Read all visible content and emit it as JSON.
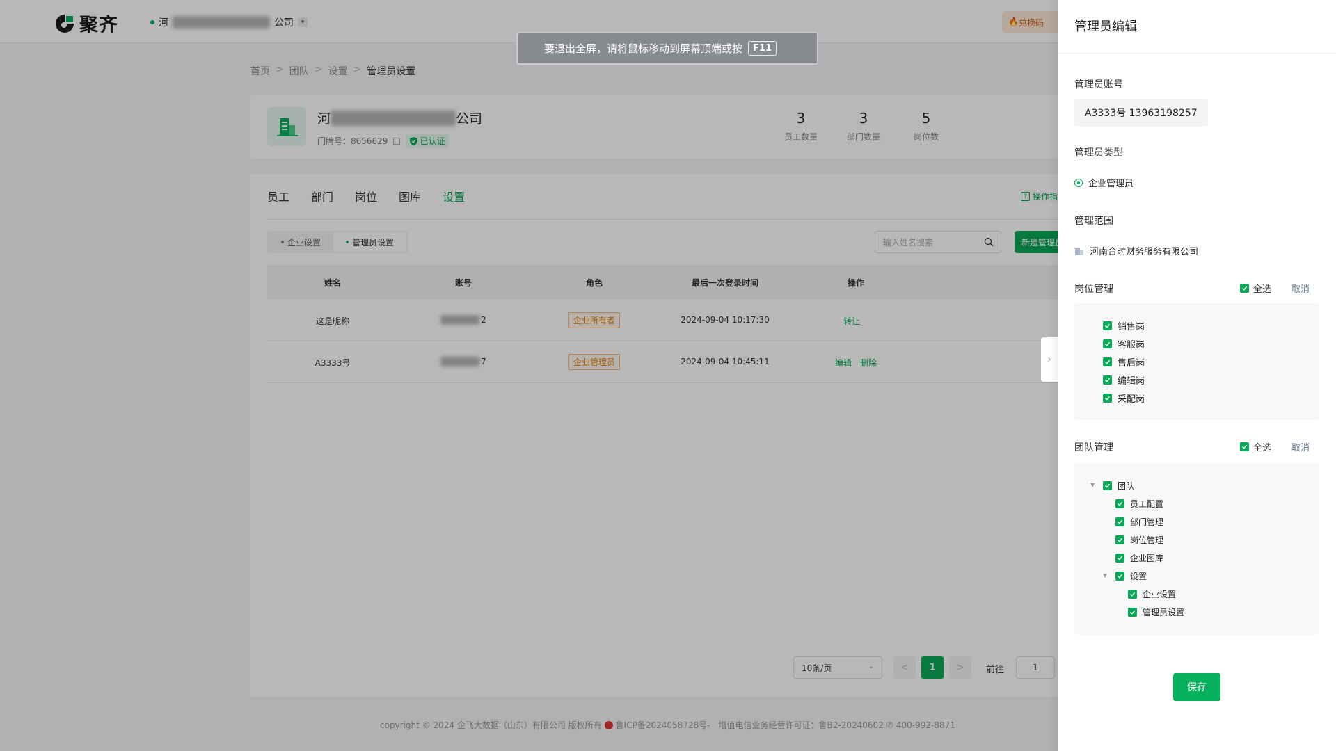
{
  "app": {
    "logo_text": "聚齐",
    "company_prefix": "河",
    "company_suffix": "公司",
    "redeem_label": "兑换码"
  },
  "fullscreen_tip": {
    "text": "要退出全屏，请将鼠标移动到屏幕顶端或按",
    "key": "F11"
  },
  "breadcrumb": {
    "items": [
      "首页",
      "团队",
      "设置"
    ],
    "current": "管理员设置",
    "separator": ">"
  },
  "company": {
    "name_prefix": "河",
    "name_suffix": "公司",
    "door_label": "门牌号：8656629",
    "verified_label": "已认证",
    "stats": [
      {
        "value": "3",
        "label": "员工数量"
      },
      {
        "value": "3",
        "label": "部门数量"
      },
      {
        "value": "5",
        "label": "岗位数"
      }
    ]
  },
  "tabs": [
    "员工",
    "部门",
    "岗位",
    "图库",
    "设置"
  ],
  "active_tab": "设置",
  "guide_label": "操作指",
  "segments": [
    "企业设置",
    "管理员设置"
  ],
  "search_placeholder": "输入姓名搜索",
  "new_button_label": "新建管理员",
  "table": {
    "headers": [
      "姓名",
      "账号",
      "角色",
      "最后一次登录时间",
      "操作"
    ],
    "rows": [
      {
        "name": "这是昵称",
        "account_tail": "2",
        "role": "企业所有者",
        "last_login": "2024-09-04 10:17:30",
        "ops": [
          "转让"
        ]
      },
      {
        "name": "A3333号",
        "account_tail": "7",
        "role": "企业管理员",
        "last_login": "2024-09-04 10:45:11",
        "ops": [
          "编辑",
          "删除"
        ]
      }
    ]
  },
  "pagination": {
    "page_size": "10条/页",
    "prev": "<",
    "current": "1",
    "next": ">",
    "goto_label": "前往",
    "goto_value": "1"
  },
  "footer": {
    "copyright": "copyright © 2024 企飞大数据（山东）有限公司 版权所有",
    "icp": "鲁ICP备2024058728号-",
    "license": "增值电信业务经营许可证：鲁B2-20240602",
    "phone": "400-992-8871"
  },
  "drawer": {
    "title": "管理员编辑",
    "account_label": "管理员账号",
    "account_value": "A3333号 13963198257",
    "type_label": "管理员类型",
    "type_value": "企业管理员",
    "scope_label": "管理范围",
    "scope_value": "河南合时财务服务有限公司",
    "post_label": "岗位管理",
    "select_all": "全选",
    "cancel": "取消",
    "posts": [
      "销售岗",
      "客服岗",
      "售后岗",
      "编辑岗",
      "采配岗"
    ],
    "team_label": "团队管理",
    "team_tree": {
      "root": "团队",
      "children": [
        "员工配置",
        "部门管理",
        "岗位管理",
        "企业图库"
      ],
      "settings": "设置",
      "settings_children": [
        "企业设置",
        "管理员设置"
      ]
    },
    "save_label": "保存"
  },
  "colors": {
    "brand": "#07a856",
    "warning": "#e0800f"
  }
}
